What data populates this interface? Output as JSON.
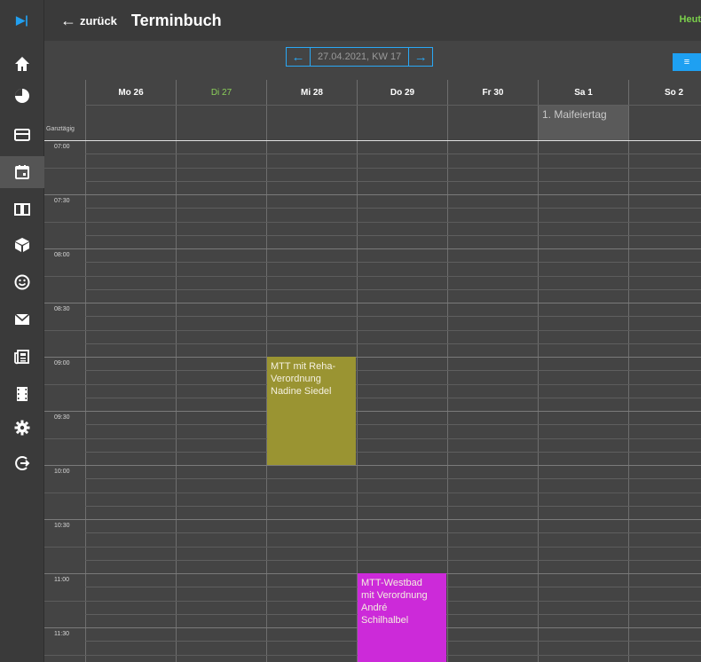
{
  "header": {
    "back_label": "zurück",
    "title": "Terminbuch",
    "today_link": "Heut"
  },
  "weeknav": {
    "prev_icon": "arrow-left-icon",
    "date_label": "27.04.2021, KW 17",
    "next_icon": "arrow-right-icon",
    "menu_icon": "list-icon"
  },
  "sidebar": {
    "items": [
      {
        "name": "home",
        "icon": "home-icon"
      },
      {
        "name": "reports",
        "icon": "pie-chart-icon"
      },
      {
        "name": "billing",
        "icon": "card-icon"
      },
      {
        "name": "calendar",
        "icon": "calendar-icon",
        "active": true
      },
      {
        "name": "book",
        "icon": "book-icon"
      },
      {
        "name": "products",
        "icon": "cube-icon"
      },
      {
        "name": "customers",
        "icon": "smiley-icon"
      },
      {
        "name": "mail",
        "icon": "mail-icon"
      },
      {
        "name": "news",
        "icon": "newspaper-icon"
      },
      {
        "name": "films",
        "icon": "film-icon"
      },
      {
        "name": "settings",
        "icon": "gear-icon"
      },
      {
        "name": "logout",
        "icon": "logout-icon"
      }
    ]
  },
  "calendar": {
    "allday_label": "Ganztägig",
    "days": [
      {
        "label": "Mo 26",
        "today": false
      },
      {
        "label": "Di 27",
        "today": true
      },
      {
        "label": "Mi 28",
        "today": false
      },
      {
        "label": "Do 29",
        "today": false
      },
      {
        "label": "Fr 30",
        "today": false
      },
      {
        "label": "Sa 1",
        "today": false
      },
      {
        "label": "So 2",
        "today": false
      }
    ],
    "times": [
      "07:00",
      "07:30",
      "08:00",
      "08:30",
      "09:00",
      "09:30",
      "10:00",
      "10:30",
      "11:00",
      "11:30"
    ],
    "holiday": {
      "day": 5,
      "label": "1. Maifeiertag"
    },
    "events": [
      {
        "day": 2,
        "start": "09:00",
        "end": "10:00",
        "lines": [
          "MTT mit Reha-",
          "Verordnung",
          "Nadine Siedel"
        ],
        "color": "#9a9432"
      },
      {
        "day": 3,
        "start": "11:00",
        "end": "12:00",
        "lines": [
          "MTT-Westbad",
          "mit Verordnung",
          "André",
          "Schilhalbel"
        ],
        "color": "#cc2ad9"
      }
    ]
  },
  "colors": {
    "accent": "#1ea0f2",
    "today": "#8bd05a",
    "background": "#444444"
  }
}
